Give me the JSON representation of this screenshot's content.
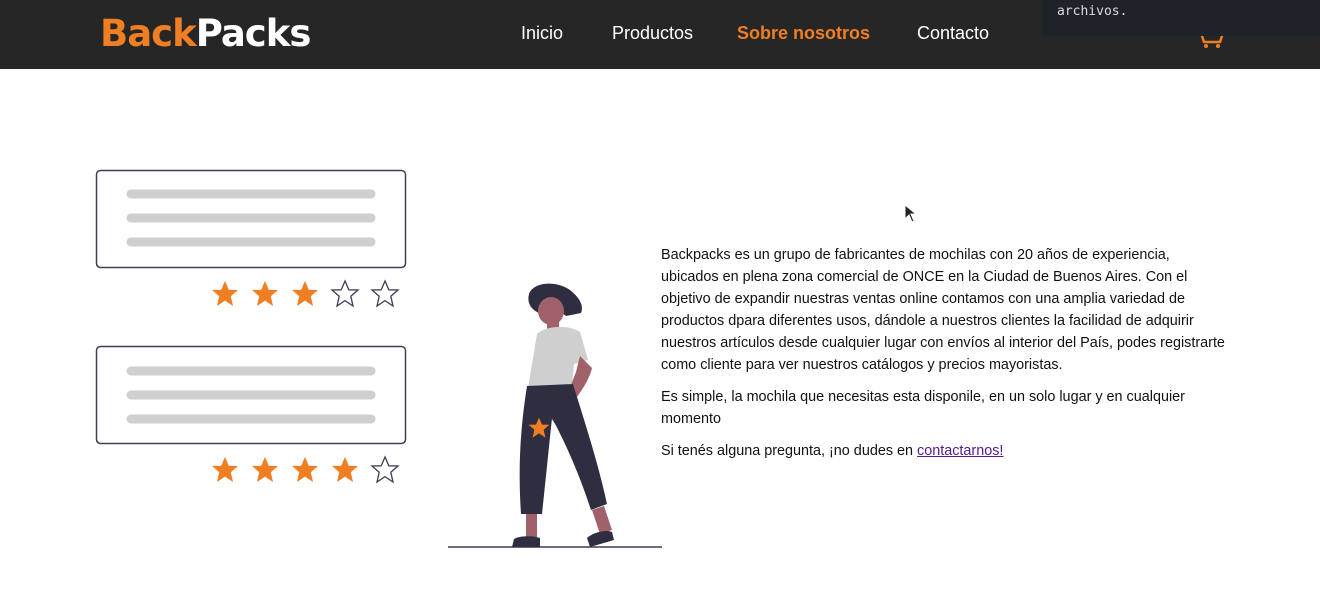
{
  "brand": {
    "part1": "Back",
    "part2": "Packs"
  },
  "nav": {
    "items": [
      {
        "label": "Inicio"
      },
      {
        "label": "Productos"
      },
      {
        "label": "Sobre nosotros"
      },
      {
        "label": "Contacto"
      }
    ],
    "active": "Sobre nosotros"
  },
  "tooltip": {
    "text": "archivos."
  },
  "reviews": [
    {
      "rating": 3,
      "max": 5
    },
    {
      "rating": 4,
      "max": 5
    }
  ],
  "about": {
    "paragraph1": "Backpacks es un grupo de fabricantes de mochilas con 20 años de experiencia, ubicados en plena zona comercial de ONCE en la Ciudad de Buenos Aires. Con el objetivo de expandir nuestras ventas online contamos con una amplia variedad de productos dpara diferentes usos, dándole a nuestros clientes la facilidad de adquirir nuestros artículos desde cualquier lugar con envíos al interior del País, podes registrarte como cliente para ver nuestros catálogos y precios mayoristas.",
    "paragraph2": "Es simple, la mochila que necesitas esta disponile, en un solo lugar y en cualquier momento",
    "paragraph3_prefix": "Si tenés alguna pregunta, ¡no dudes en ",
    "paragraph3_link": "contactarnos!"
  },
  "colors": {
    "accent": "#f07f24",
    "navbar": "#262626",
    "text": "#111111",
    "link": "#551a8b"
  },
  "icons": [
    "cart-icon",
    "star-icon",
    "cursor-icon"
  ]
}
